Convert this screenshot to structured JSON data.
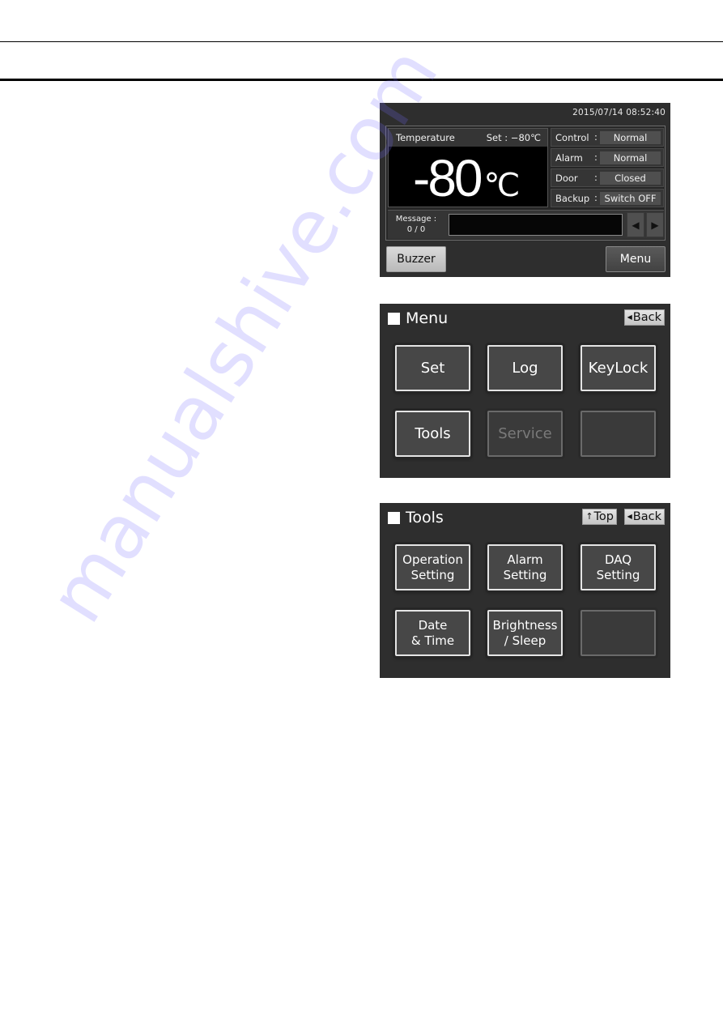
{
  "status_screen": {
    "datetime": "2015/07/14  08:52:40",
    "temperature_label": "Temperature",
    "set_label": "Set :  −80℃",
    "current_temperature": "-80",
    "temperature_unit": "℃",
    "status_rows": [
      {
        "key": "Control",
        "colon": ":",
        "value": "Normal"
      },
      {
        "key": "Alarm",
        "colon": ":",
        "value": "Normal"
      },
      {
        "key": "Door",
        "colon": ":",
        "value": "Closed"
      },
      {
        "key": "Backup",
        "colon": ":",
        "value": "Switch OFF"
      }
    ],
    "message_label": "Message :",
    "message_count": "0 / 0",
    "message_text": "",
    "prev_icon": "◀",
    "next_icon": "▶",
    "buzzer_label": "Buzzer",
    "menu_label": "Menu"
  },
  "menu_screen": {
    "title": "Menu",
    "back_icon": "◀",
    "back_label": "Back",
    "buttons": [
      {
        "label": "Set",
        "state": "enabled"
      },
      {
        "label": "Log",
        "state": "enabled"
      },
      {
        "label": "KeyLock",
        "state": "enabled"
      },
      {
        "label": "Tools",
        "state": "enabled"
      },
      {
        "label": "Service",
        "state": "disabled"
      },
      {
        "label": "",
        "state": "empty"
      }
    ]
  },
  "tools_screen": {
    "title": "Tools",
    "top_icon": "🡅",
    "top_label": "Top",
    "back_icon": "◀",
    "back_label": "Back",
    "buttons": [
      {
        "line1": "Operation",
        "line2": "Setting",
        "state": "enabled"
      },
      {
        "line1": "Alarm",
        "line2": "Setting",
        "state": "enabled"
      },
      {
        "line1": "DAQ",
        "line2": "Setting",
        "state": "enabled"
      },
      {
        "line1": "Date",
        "line2": "& Time",
        "state": "enabled"
      },
      {
        "line1": "Brightness",
        "line2": "/ Sleep",
        "state": "enabled"
      },
      {
        "line1": "",
        "line2": "",
        "state": "empty"
      }
    ]
  },
  "watermark": "manualshive.com"
}
